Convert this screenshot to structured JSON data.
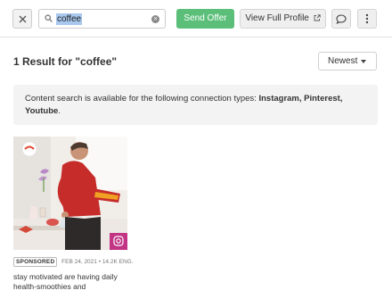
{
  "toolbar": {
    "search_value": "coffee",
    "send_offer_label": "Send Offer",
    "view_profile_label": "View Full Profile",
    "send_offer_color": "#5bbf7a"
  },
  "results": {
    "title": "1 Result for \"coffee\"",
    "sort_label": "Newest"
  },
  "notice": {
    "text_prefix": "Content search is available for the following connection types: ",
    "types": "Instagram, Pinterest, Youtube",
    "text_suffix": "."
  },
  "post": {
    "badge": "SPONSORED",
    "date": "FEB 24, 2021",
    "separator": "•",
    "engagement": "14.2K ENG.",
    "caption_line1": "stay motivated are having daily",
    "caption_line2": "health-smoothies and",
    "platform_icon": "instagram-icon",
    "platform_color": "#c13584"
  }
}
